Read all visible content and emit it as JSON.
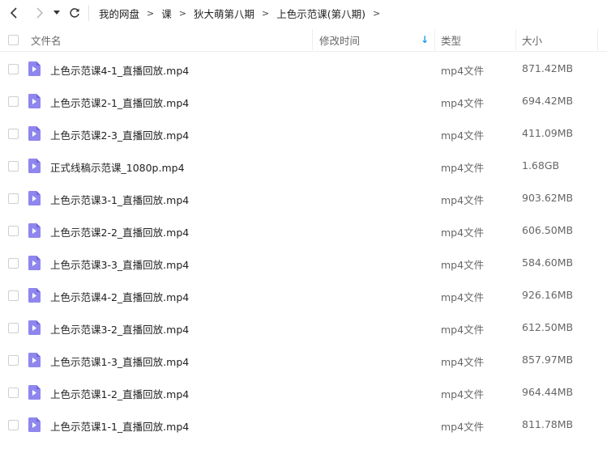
{
  "breadcrumb": [
    "我的网盘",
    "课",
    "狄大萌第八期",
    "上色示范课(第八期)"
  ],
  "header": {
    "name": "文件名",
    "modified": "修改时间",
    "type": "类型",
    "size": "大小",
    "sort_indicator": "↓"
  },
  "colors": {
    "accent": "#1f9bea",
    "file_icon": "#8f86ee",
    "file_icon_dark": "#6f64e0"
  },
  "files": [
    {
      "name": "上色示范课4-1_直播回放.mp4",
      "type": "mp4文件",
      "size": "871.42MB"
    },
    {
      "name": "上色示范课2-1_直播回放.mp4",
      "type": "mp4文件",
      "size": "694.42MB"
    },
    {
      "name": "上色示范课2-3_直播回放.mp4",
      "type": "mp4文件",
      "size": "411.09MB"
    },
    {
      "name": "正式线稿示范课_1080p.mp4",
      "type": "mp4文件",
      "size": "1.68GB"
    },
    {
      "name": "上色示范课3-1_直播回放.mp4",
      "type": "mp4文件",
      "size": "903.62MB"
    },
    {
      "name": "上色示范课2-2_直播回放.mp4",
      "type": "mp4文件",
      "size": "606.50MB"
    },
    {
      "name": "上色示范课3-3_直播回放.mp4",
      "type": "mp4文件",
      "size": "584.60MB"
    },
    {
      "name": "上色示范课4-2_直播回放.mp4",
      "type": "mp4文件",
      "size": "926.16MB"
    },
    {
      "name": "上色示范课3-2_直播回放.mp4",
      "type": "mp4文件",
      "size": "612.50MB"
    },
    {
      "name": "上色示范课1-3_直播回放.mp4",
      "type": "mp4文件",
      "size": "857.97MB"
    },
    {
      "name": "上色示范课1-2_直播回放.mp4",
      "type": "mp4文件",
      "size": "964.44MB"
    },
    {
      "name": "上色示范课1-1_直播回放.mp4",
      "type": "mp4文件",
      "size": "811.78MB"
    }
  ]
}
